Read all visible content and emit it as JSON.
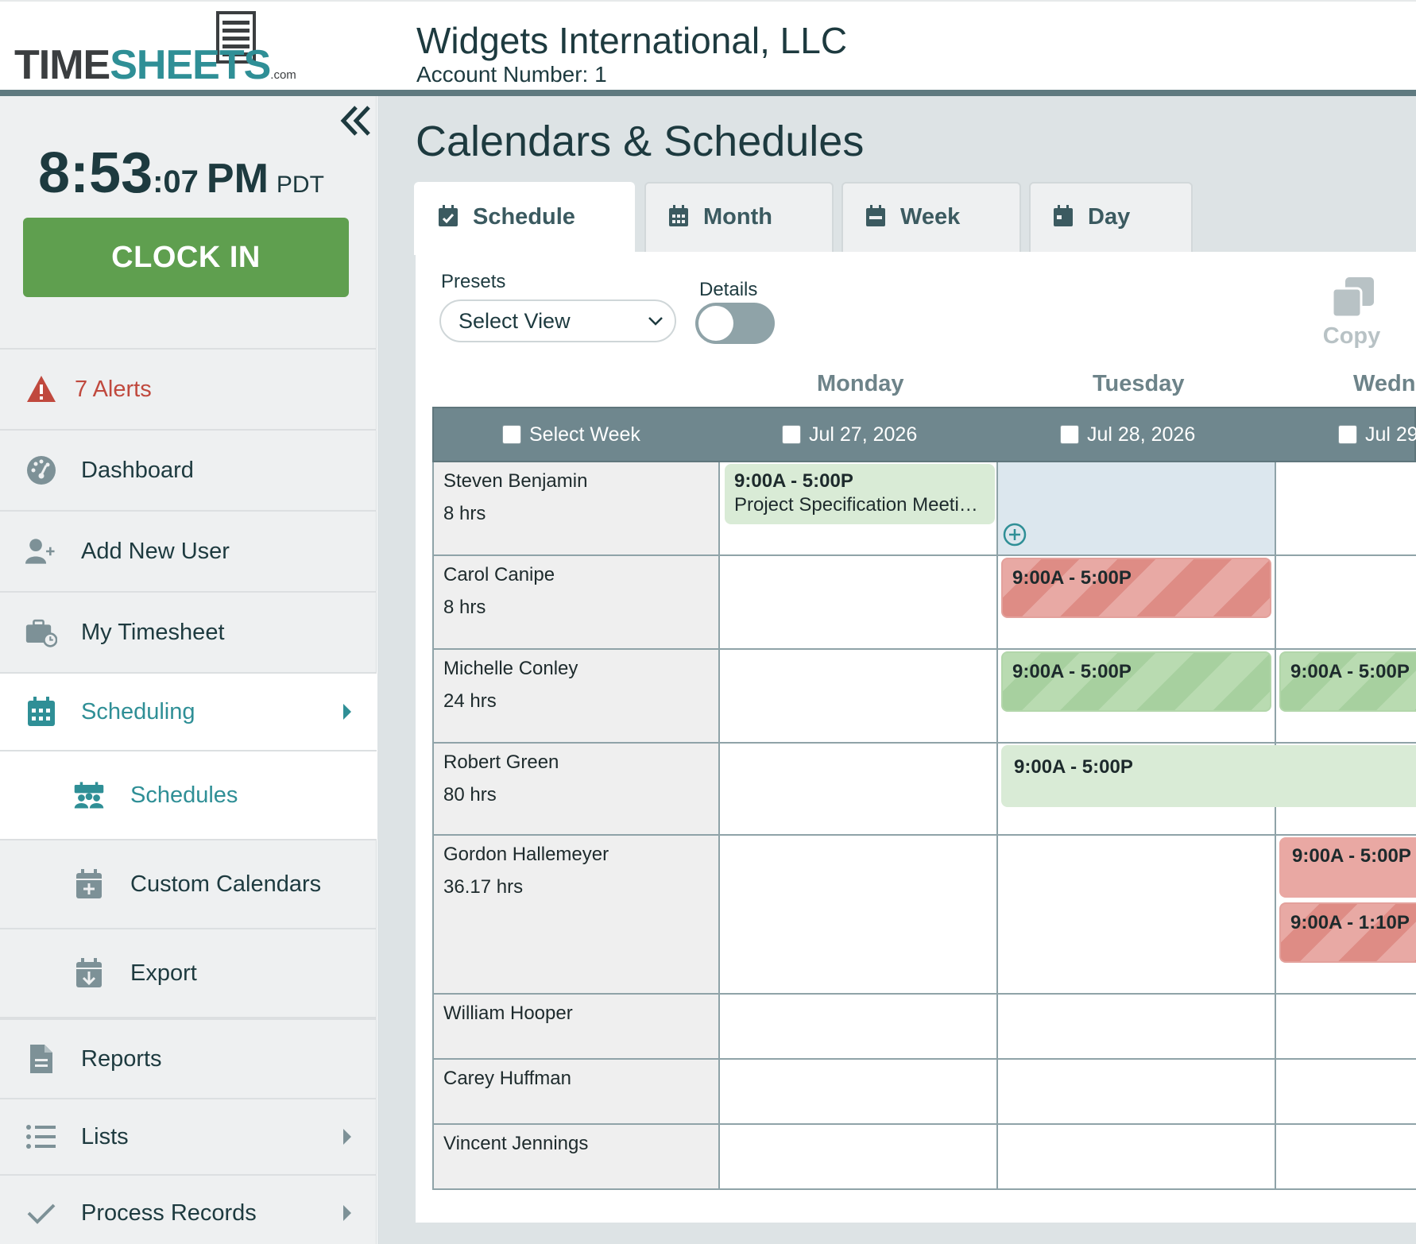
{
  "header": {
    "logo_part1": "TIME",
    "logo_part2": "SHEETS",
    "logo_suffix": ".com",
    "company": "Widgets International, LLC",
    "account": "Account Number: 1"
  },
  "clock": {
    "hm": "8:53",
    "sec": ":07",
    "ampm": "PM",
    "tz": "PDT",
    "button": "CLOCK IN"
  },
  "sidebar": {
    "alerts": "7 Alerts",
    "dashboard": "Dashboard",
    "add_user": "Add New User",
    "my_timesheet": "My Timesheet",
    "scheduling": "Scheduling",
    "schedules": "Schedules",
    "custom_calendars": "Custom Calendars",
    "export": "Export",
    "reports": "Reports",
    "lists": "Lists",
    "process_records": "Process Records"
  },
  "page": {
    "title": "Calendars & Schedules",
    "tabs": {
      "schedule": "Schedule",
      "month": "Month",
      "week": "Week",
      "day": "Day"
    },
    "presets_label": "Presets",
    "presets_value": "Select View",
    "details_label": "Details",
    "copy_label": "Copy"
  },
  "grid": {
    "days": {
      "mon": "Monday",
      "tue": "Tuesday",
      "wed": "Wedne"
    },
    "select_week": "Select Week",
    "dates": {
      "mon": "Jul 27, 2026",
      "tue": "Jul 28, 2026",
      "wed": "Jul 29"
    },
    "rows": [
      {
        "name": "Steven Benjamin",
        "hours": "8 hrs"
      },
      {
        "name": "Carol Canipe",
        "hours": "8 hrs"
      },
      {
        "name": "Michelle Conley",
        "hours": "24 hrs"
      },
      {
        "name": "Robert Green",
        "hours": "80 hrs"
      },
      {
        "name": "Gordon Hallemeyer",
        "hours": "36.17 hrs"
      },
      {
        "name": "William Hooper",
        "hours": ""
      },
      {
        "name": "Carey Huffman",
        "hours": ""
      },
      {
        "name": "Vincent Jennings",
        "hours": ""
      }
    ],
    "shifts": {
      "steven_mon_time": "9:00A - 5:00P",
      "steven_mon_desc": "Project Specification Meeti…",
      "carol_tue": "9:00A - 5:00P",
      "michelle_tue": "9:00A - 5:00P",
      "michelle_wed": "9:00A - 5:00P",
      "robert_tue": "9:00A - 5:00P",
      "gordon_wed_1": "9:00A - 5:00P",
      "gordon_wed_2": "9:00A - 1:10P"
    }
  },
  "colors": {
    "accent": "#2f8f96",
    "clock_in": "#5f9f4f",
    "alert": "#c0493e",
    "grid_header": "#6f878e",
    "shift_green": "#d9ebd6",
    "shift_red": "#e9a8a3"
  }
}
